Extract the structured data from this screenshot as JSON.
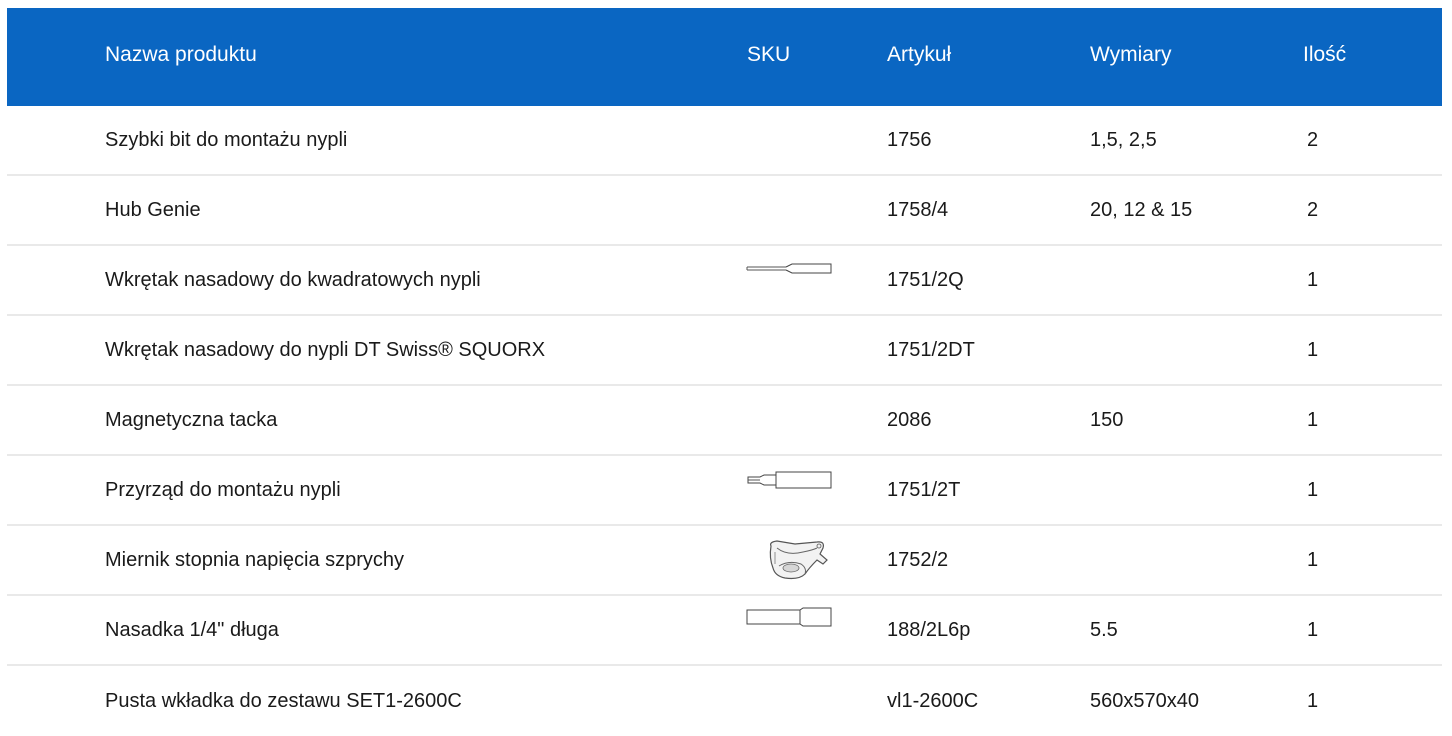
{
  "table": {
    "headers": {
      "name": "Nazwa produktu",
      "sku": "SKU",
      "article": "Artykuł",
      "dimensions": "Wymiary",
      "quantity": "Ilość"
    },
    "rows": [
      {
        "name": "Szybki bit do montażu nypli",
        "sku_icon": "",
        "article": "1756",
        "dimensions": "1,5, 2,5",
        "quantity": "2"
      },
      {
        "name": "Hub Genie",
        "sku_icon": "",
        "article": "1758/4",
        "dimensions": "20, 12 & 15",
        "quantity": "2"
      },
      {
        "name": "Wkrętak nasadowy do kwadratowych nypli",
        "sku_icon": "screwdriver-icon",
        "article": "1751/2Q",
        "dimensions": "",
        "quantity": "1"
      },
      {
        "name": "Wkrętak nasadowy do nypli DT Swiss® SQUORX",
        "sku_icon": "",
        "article": "1751/2DT",
        "dimensions": "",
        "quantity": "1"
      },
      {
        "name": "Magnetyczna tacka",
        "sku_icon": "",
        "article": "2086",
        "dimensions": "150",
        "quantity": "1"
      },
      {
        "name": "Przyrząd do montażu nypli",
        "sku_icon": "nipple-tool-icon",
        "article": "1751/2T",
        "dimensions": "",
        "quantity": "1"
      },
      {
        "name": "Miernik stopnia napięcia szprychy",
        "sku_icon": "tension-meter-icon",
        "article": "1752/2",
        "dimensions": "",
        "quantity": "1"
      },
      {
        "name": "Nasadka 1/4\" długa",
        "sku_icon": "socket-icon",
        "article": "188/2L6p",
        "dimensions": "5.5",
        "quantity": "1"
      },
      {
        "name": "Pusta wkładka do zestawu SET1-2600C",
        "sku_icon": "",
        "article": "vl1-2600C",
        "dimensions": "560x570x40",
        "quantity": "1"
      }
    ]
  },
  "colors": {
    "header_bg": "#0a66c2",
    "header_text": "#ffffff",
    "row_divider": "#e9e9e9"
  }
}
